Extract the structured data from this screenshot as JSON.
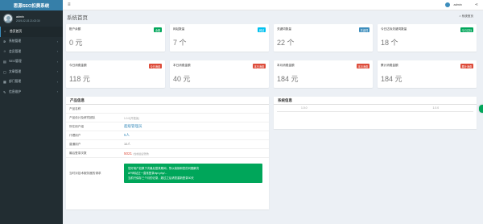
{
  "header": {
    "logo": "思源SEO扣费系统",
    "menu_icon": "≡",
    "user_name": "admin",
    "share_icon": "share-icon"
  },
  "sidebar": {
    "user": {
      "name": "admin",
      "time": "2019-02-03 21:02:30"
    },
    "items": [
      {
        "label": "首页首页",
        "icon": "home-icon",
        "active": true
      },
      {
        "label": "系统管理",
        "icon": "gear-icon",
        "arrow": "‹"
      },
      {
        "label": "会员管理",
        "icon": "users-icon",
        "arrow": "‹"
      },
      {
        "label": "SEO管理",
        "icon": "chart-icon",
        "arrow": "‹"
      },
      {
        "label": "文章管理",
        "icon": "file-icon",
        "arrow": "‹"
      },
      {
        "label": "部门管理",
        "icon": "sitemap-icon",
        "arrow": "‹"
      },
      {
        "label": "信息维护",
        "icon": "wrench-icon",
        "arrow": "‹"
      }
    ]
  },
  "page": {
    "title": "系统首页",
    "breadcrumb": "系统首页",
    "breadcrumb_icon": "home-icon"
  },
  "stats_row1": [
    {
      "label": "账户余额",
      "badge": "余额",
      "badge_color": "#00a65a",
      "value": "0 元"
    },
    {
      "label": "网站数量",
      "badge": "网站",
      "badge_color": "#00c0ef",
      "value": "7 个"
    },
    {
      "label": "关键词数量",
      "badge": "关键词",
      "badge_color": "#3c8dbc",
      "value": "22 个"
    },
    {
      "label": "今日达标关键词数量",
      "badge": "今日达标",
      "badge_color": "#00a65a",
      "value": "18 个"
    }
  ],
  "stats_row2": [
    {
      "label": "今日消费金额",
      "badge": "今日消费",
      "badge_color": "#dd4b39",
      "value": "118 元"
    },
    {
      "label": "本日消费金额",
      "badge": "本日消费",
      "badge_color": "#dd4b39",
      "value": "40 元"
    },
    {
      "label": "本月消费金额",
      "badge": "本月消费",
      "badge_color": "#dd4b39",
      "value": "184 元"
    },
    {
      "label": "累计消费金额",
      "badge": "累计消费",
      "badge_color": "#dd4b39",
      "value": "184 元"
    }
  ],
  "product_panel": {
    "title": "产品信息",
    "rows": [
      {
        "key": "产品名称",
        "value": ""
      },
      {
        "key": "产品设计及研究团队",
        "value": "",
        "v2": "1.0.0(开发版)"
      },
      {
        "key": "所在用户组",
        "value": "超级管理员"
      },
      {
        "key": "代理用户",
        "value": "5人"
      },
      {
        "key": "普通用户",
        "value": "10人"
      },
      {
        "key": "最后登录次数",
        "value": "5021",
        "note": "(当前最后登录)"
      }
    ],
    "notice_key": "当时对技术服务器的请求",
    "notice_lines": [
      "您好用户如果下次最后登录期间，所以我就和您的问题解决",
      "API网站正一直常登录/api.php/...",
      "当前只保存三个月的记录，超过之后请您重新登录30天"
    ]
  },
  "system_panel": {
    "title": "系统信息",
    "version_a": "1.0.0",
    "version_b": "1.0.0"
  }
}
